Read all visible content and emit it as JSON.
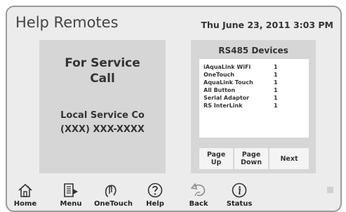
{
  "header": {
    "title": "Help Remotes",
    "datetime": "Thu June 23, 2011  3:03 PM"
  },
  "service": {
    "heading_line1": "For Service",
    "heading_line2": "Call",
    "company": "Local Service Co",
    "phone": "(XXX) XXX-XXXX"
  },
  "devices": {
    "title": "RS485 Devices",
    "items": [
      {
        "name": "iAquaLink WiFi",
        "count": "1"
      },
      {
        "name": "OneTouch",
        "count": "1"
      },
      {
        "name": "AquaLink Touch",
        "count": "1"
      },
      {
        "name": "All Button",
        "count": "1"
      },
      {
        "name": "Serial Adaptor",
        "count": "1"
      },
      {
        "name": "RS InterLink",
        "count": "1"
      }
    ],
    "buttons": {
      "page_up": "Page\nUp",
      "page_down": "Page\nDown",
      "next": "Next"
    }
  },
  "nav": {
    "home": {
      "label": "Home",
      "icon": "home-icon"
    },
    "menu": {
      "label": "Menu",
      "icon": "menu-icon"
    },
    "onetouch": {
      "label": "OneTouch",
      "icon": "onetouch-icon"
    },
    "help": {
      "label": "Help",
      "icon": "help-icon"
    },
    "back": {
      "label": "Back",
      "icon": "back-icon"
    },
    "status": {
      "label": "Status",
      "icon": "info-icon"
    }
  },
  "colors": {
    "background": "#ececec",
    "panel": "#d6d6d6",
    "border": "#9a9a9a"
  }
}
